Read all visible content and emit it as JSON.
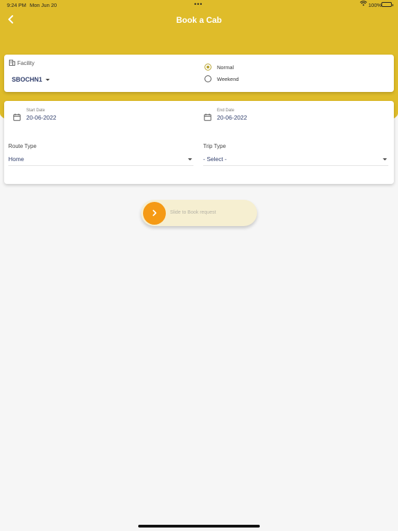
{
  "status_bar": {
    "time": "9:24 PM",
    "date": "Mon Jun 20",
    "dots": "•••",
    "wifi_icon": "wifi-icon",
    "battery": "100%"
  },
  "header": {
    "title": "Book a Cab",
    "back_icon": "chevron-left-icon",
    "color": "#dfbc2a"
  },
  "facility": {
    "label": "Facility",
    "value": "SBOCHN1",
    "icon": "building-icon"
  },
  "day_type": {
    "options": [
      "Normal",
      "Weekend"
    ],
    "selected": "Normal",
    "accent": "#b6a12c"
  },
  "dates": {
    "start_label": "Start Date",
    "start_value": "20-06-2022",
    "end_label": "End Date",
    "end_value": "20-06-2022",
    "icon": "calendar-icon"
  },
  "route_type": {
    "label": "Route Type",
    "value": "Home"
  },
  "trip_type": {
    "label": "Trip Type",
    "value": "- Select -"
  },
  "slider": {
    "text": "Slide to Book request",
    "knob_color": "#f59a14",
    "icon": "chevron-right-icon"
  }
}
